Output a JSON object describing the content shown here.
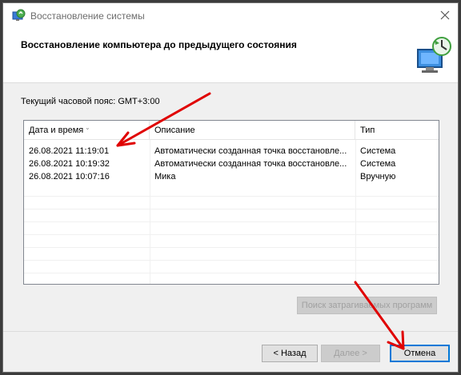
{
  "window": {
    "title": "Восстановление системы",
    "header_title": "Восстановление компьютера до предыдущего состояния",
    "icons": {
      "title": "system-restore-icon",
      "header": "system-restore-large-icon",
      "close": "close-icon"
    }
  },
  "timezone_label": "Текущий часовой пояс: GMT+3:00",
  "table": {
    "columns": [
      "Дата и время",
      "Описание",
      "Тип"
    ],
    "sorted_column": "Дата и время",
    "rows": [
      {
        "date": "26.08.2021 11:19:01",
        "description": "Автоматически созданная точка восстановле...",
        "type": "Система"
      },
      {
        "date": "26.08.2021 10:19:32",
        "description": "Автоматически созданная точка восстановле...",
        "type": "Система"
      },
      {
        "date": "26.08.2021 10:07:16",
        "description": "Мика",
        "type": "Вручную"
      }
    ]
  },
  "buttons": {
    "scan": "Поиск затрагиваемых программ",
    "back": "< Назад",
    "next": "Далее >",
    "cancel": "Отмена"
  },
  "annotation_color": "#e00000"
}
